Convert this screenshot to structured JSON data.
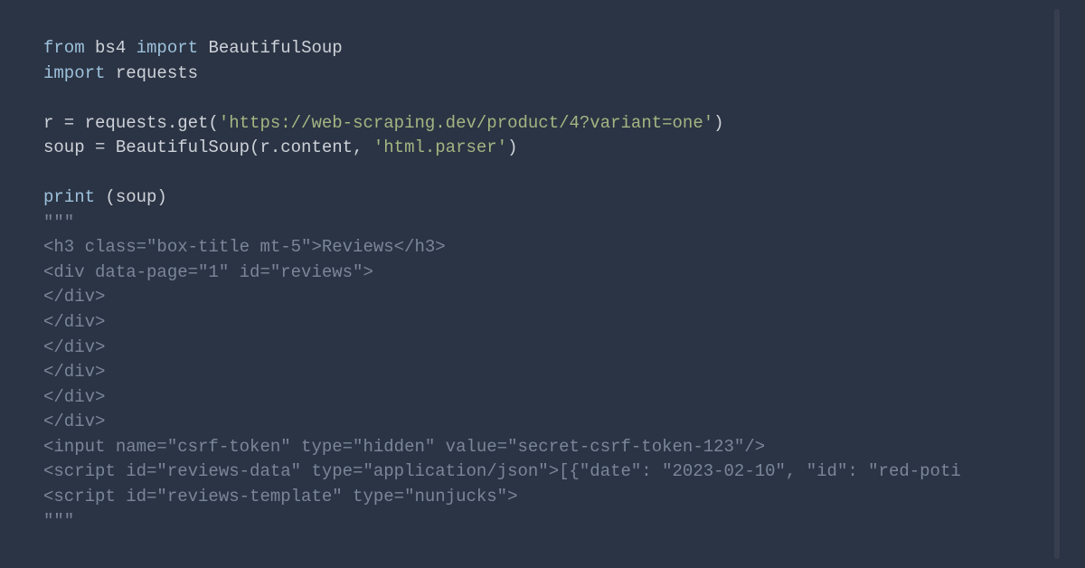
{
  "code": {
    "l1_kw1": "from",
    "l1_mod": " bs4 ",
    "l1_kw2": "import",
    "l1_cls": " BeautifulSoup",
    "l2_kw": "import",
    "l2_mod": " requests",
    "l4_a": "r = requests.get(",
    "l4_s": "'https://web-scraping.dev/product/4?variant=one'",
    "l4_b": ")",
    "l5_a": "soup = BeautifulSoup(r.content, ",
    "l5_s": "'html.parser'",
    "l5_b": ")",
    "l7_a": "print",
    "l7_b": " (soup)",
    "l8": "\"\"\"",
    "l9": "<h3 class=\"box-title mt-5\">Reviews</h3>",
    "l10": "<div data-page=\"1\" id=\"reviews\">",
    "l11": "</div>",
    "l12": "</div>",
    "l13": "</div>",
    "l14": "</div>",
    "l15": "</div>",
    "l16": "</div>",
    "l17": "<input name=\"csrf-token\" type=\"hidden\" value=\"secret-csrf-token-123\"/>",
    "l18": "<script id=\"reviews-data\" type=\"application/json\">[{\"date\": \"2023-02-10\", \"id\": \"red-poti",
    "l19": "<script id=\"reviews-template\" type=\"nunjucks\">",
    "l20": "\"\"\""
  }
}
